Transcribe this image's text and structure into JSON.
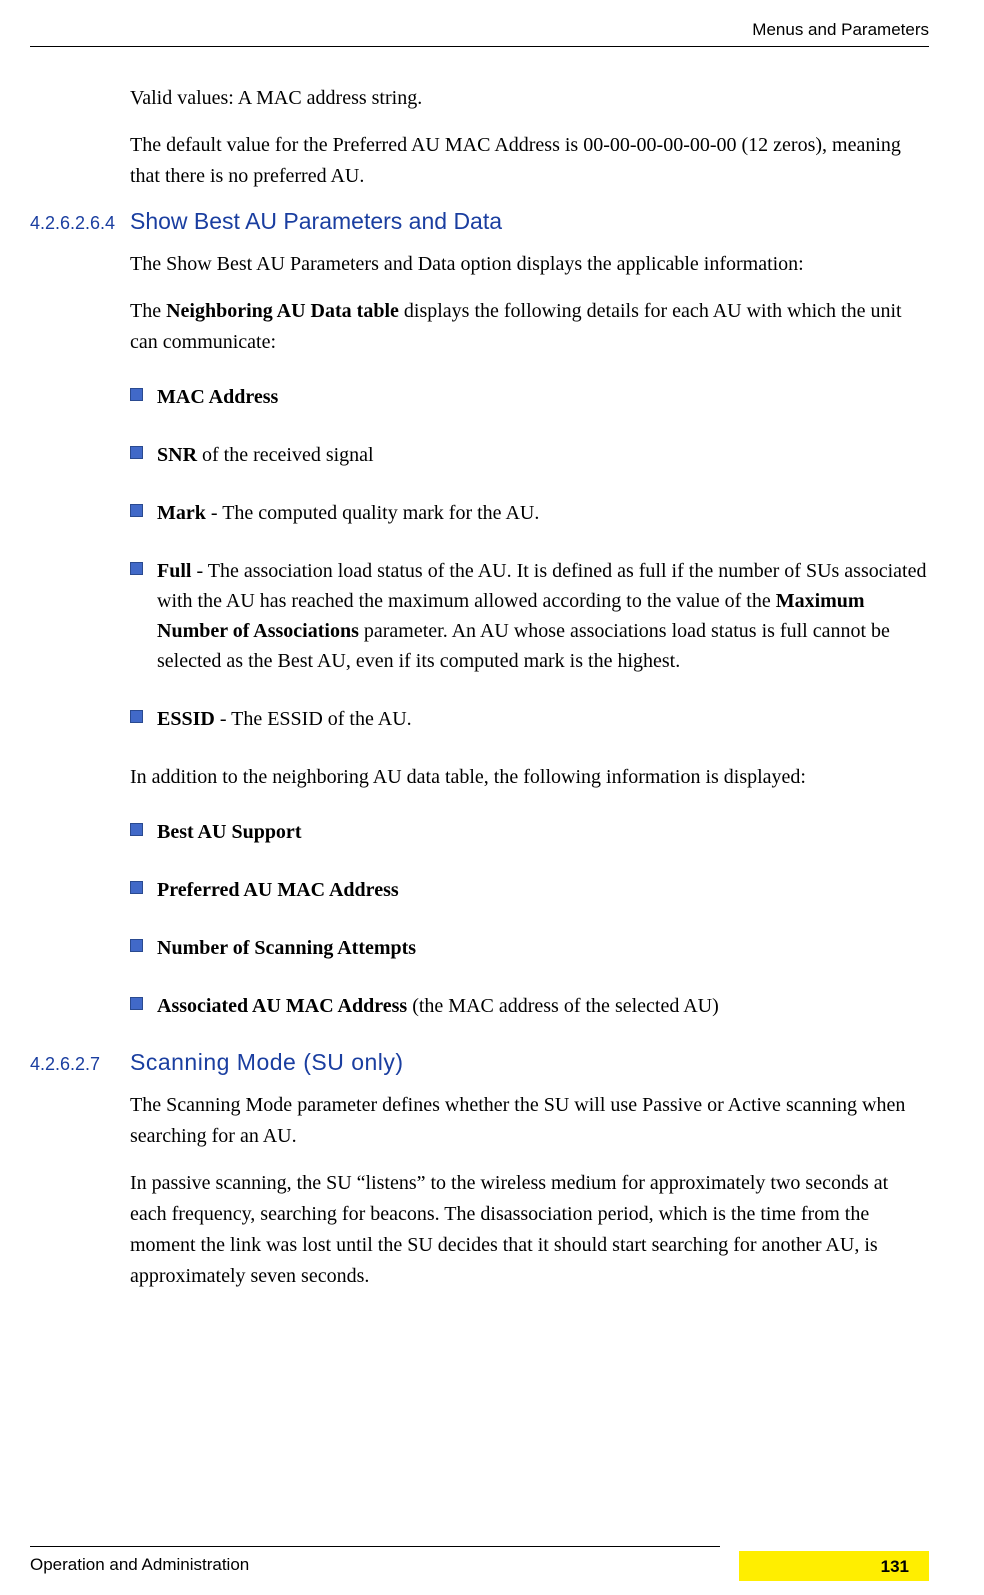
{
  "header": {
    "chapter": "Menus and Parameters"
  },
  "intro": {
    "valid_values": "Valid values: A MAC address string.",
    "default_value": "The default value for the Preferred AU MAC Address is 00-00-00-00-00-00 (12 zeros), meaning that there is no preferred AU."
  },
  "section1": {
    "number": "4.2.6.2.6.4",
    "title": "Show Best AU Parameters and Data",
    "para1": "The Show Best AU Parameters and Data option displays the applicable information:",
    "para2_prefix": "The ",
    "para2_bold": "Neighboring AU Data table",
    "para2_suffix": " displays the following details for each AU with which the unit can communicate:",
    "bullets1": [
      {
        "bold": "MAC Address",
        "rest": ""
      },
      {
        "bold": "SNR",
        "rest": " of the received signal"
      },
      {
        "bold": "Mark",
        "rest": " - The computed quality mark for the AU."
      },
      {
        "bold": "Full",
        "rest_pre": " - The association load status of the AU. It is defined as full if the number of SUs associated with the AU has reached the maximum allowed according to the value of the ",
        "bold2": "Maximum Number of Associations",
        "rest_post": " parameter. An AU whose associations load status is full cannot be selected as the Best AU, even if its computed mark is the highest."
      },
      {
        "bold": "ESSID",
        "rest": " - The ESSID of the AU."
      }
    ],
    "para3": "In addition to the neighboring AU data table, the following information is displayed:",
    "bullets2": [
      {
        "bold": "Best AU Support",
        "rest": ""
      },
      {
        "bold": "Preferred AU MAC Address",
        "rest": ""
      },
      {
        "bold": "Number of Scanning Attempts",
        "rest": ""
      },
      {
        "bold": "Associated AU MAC Address",
        "rest": " (the MAC address of the selected AU)"
      }
    ]
  },
  "section2": {
    "number": "4.2.6.2.7",
    "title": "Scanning Mode (SU only)",
    "para1": "The Scanning Mode parameter defines whether the SU will use Passive or Active scanning when searching for an AU.",
    "para2": "In passive scanning, the SU “listens” to the wireless medium for approximately two seconds at each frequency, searching for beacons. The disassociation period, which is the time from the moment the link was lost until the SU decides that it should start searching for another AU, is approximately seven seconds."
  },
  "footer": {
    "text": "Operation and Administration",
    "page": "131"
  }
}
